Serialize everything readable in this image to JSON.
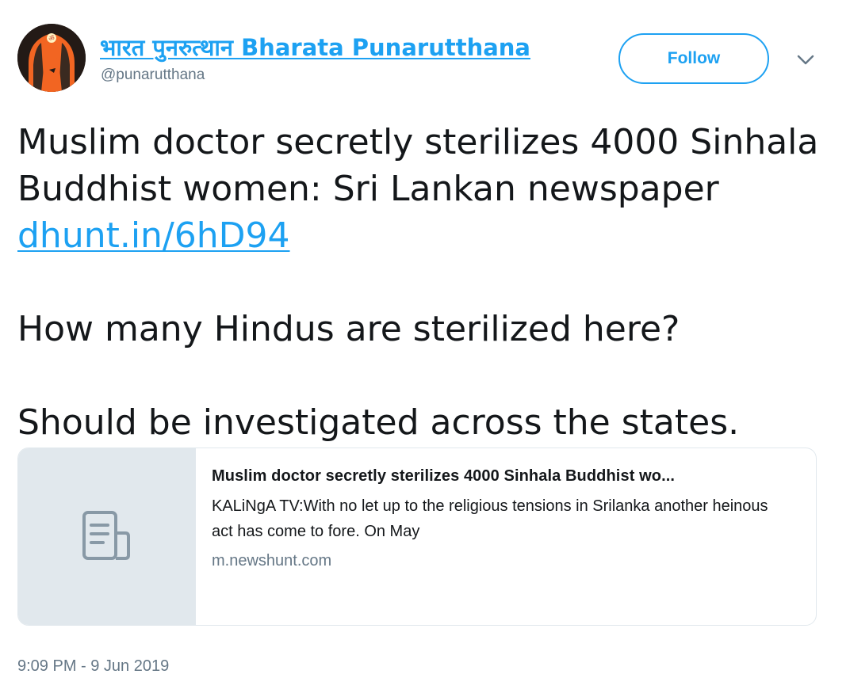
{
  "author": {
    "display_name": "भारत पुनरुत्थान Bharata Punarutthana",
    "handle": "@punarutthana",
    "avatar_icon": "om-temple-avatar-icon"
  },
  "actions": {
    "follow_label": "Follow",
    "more_icon": "chevron-down-icon"
  },
  "tweet": {
    "line1": "Muslim doctor secretly sterilizes 4000 Sinhala",
    "line2": "Buddhist women: Sri Lankan newspaper",
    "link": "dhunt.in/6hD94",
    "paragraph2": "How many Hindus are sterilized here?",
    "paragraph3": "Should be investigated across the states."
  },
  "card": {
    "media_icon": "document-icon",
    "title": "Muslim doctor secretly sterilizes 4000 Sinhala Buddhist wo...",
    "description": "KALiNgA TV:With no let up to the religious tensions in Srilanka another heinous act has come to fore. On May",
    "domain": "m.newshunt.com"
  },
  "timestamp": "9:09 PM - 9 Jun 2019",
  "colors": {
    "accent": "#1da1f2",
    "text": "#14171a",
    "secondary_text": "#657786",
    "card_media_bg": "#e1e8ed",
    "avatar_orange": "#f26522"
  }
}
